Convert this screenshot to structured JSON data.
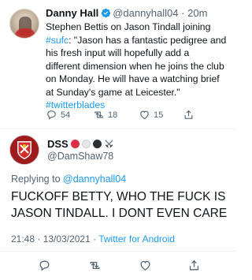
{
  "tweet": {
    "author_name": "Danny Hall",
    "handle": "@dannyhall04",
    "separator": "·",
    "time": "20m",
    "lines": [
      [
        {
          "t": "Stephen Bettis on Jason Tindall joining",
          "link": false
        }
      ],
      [
        {
          "t": "#sufc",
          "link": true
        },
        {
          "t": ": \"Jason has a fantastic pedigree and",
          "link": false
        }
      ],
      [
        {
          "t": "his fresh input will hopefully add a",
          "link": false
        }
      ],
      [
        {
          "t": "different dimension when he joins the club",
          "link": false
        }
      ],
      [
        {
          "t": "on Monday. He will have a watching brief",
          "link": false
        }
      ],
      [
        {
          "t": "at Sunday's game at Leicester.\"",
          "link": false
        }
      ],
      [
        {
          "t": "#twitterblades",
          "link": true
        }
      ]
    ],
    "replies": "54",
    "retweets": "18",
    "likes": "15"
  },
  "reply": {
    "author_name": "DSS",
    "name_emojis": [
      "red-circle",
      "white-circle",
      "black-circle",
      "crossed-swords"
    ],
    "handle": "@DamShaw78",
    "replying_prefix": "Replying to",
    "replying_to": "@dannyhall04",
    "text_lines": [
      "FUCKOFF BETTY, WHO THE FUCK IS",
      "JASON TINDALL. I DONT EVEN CARE"
    ],
    "timestamp": "21:48 · 13/03/2021 ·",
    "source": "Twitter for Android"
  },
  "colors": {
    "link": "#1d9bf0",
    "secondary_text": "#536471",
    "verified": "#1d9bf0",
    "emoji_red": "#dd2e44",
    "emoji_white": "#e6e7e8",
    "emoji_black": "#292f33"
  }
}
